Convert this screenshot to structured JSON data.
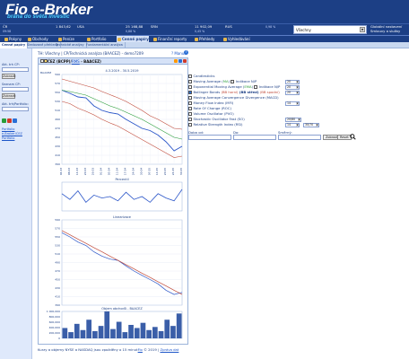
{
  "header": {
    "logo_main": "Fio e-Broker",
    "logo_tag": "brána do světa investic"
  },
  "ticker": [
    {
      "name": "ČR",
      "sub": "09:58",
      "value": "1 843,62",
      "change": ""
    },
    {
      "name": "USA",
      "sub": "",
      "value": "25 168,88",
      "change": "0,88 %"
    },
    {
      "name": "SRN",
      "sub": "",
      "value": "11 902,09",
      "change": "0,45 %"
    },
    {
      "name": "RUS",
      "sub": "",
      "value": "",
      "change": "0,98 %"
    }
  ],
  "account": {
    "selected": "Všechny"
  },
  "side_note": [
    "Globální nastavení",
    "Smlouvy a služby"
  ],
  "nav": [
    {
      "label": "Pokyny"
    },
    {
      "label": "Obchody"
    },
    {
      "label": "Peníze"
    },
    {
      "label": "Portfolio"
    },
    {
      "label": "Cenné papíry"
    },
    {
      "label": "Finanční reporty"
    },
    {
      "label": "Přehledy"
    },
    {
      "label": "Vyhledávání"
    }
  ],
  "subnav": [
    {
      "label": "Cenné papíry"
    },
    {
      "label": "Sledované přehledy"
    },
    {
      "label": "Technické analýzy"
    },
    {
      "label": "Fundamentální analýza"
    }
  ],
  "sidebar": {
    "label1": "Akt. trh CP:",
    "btn1": "Zobrazit",
    "label2": "Seznam CP:",
    "btn2": "Zobrazit",
    "label3": "Akt. trh/Portfolio:",
    "link1": "Portfolio",
    "link2": "e-Broker/ČEZ",
    "link3": "Portfolio"
  },
  "breadcrumb": "TH: Všechny | CP/Technická analýza (BAACEZ) - demo7209",
  "manual_label": "Manuál",
  "panel": {
    "title_prefix": "ČEZ (BCPP)/",
    "title_link": "RMS",
    "title_suffix": " - BAACEZ)"
  },
  "options": {
    "candlesticks": "Candlesticks",
    "ma_prefix": "Moving Average (",
    "ma_green": "MA",
    "ma_suffix": ")",
    "ind_np": "Indikace N/P",
    "ema_prefix": "Exponential Moving Average (",
    "ema_green": "EMA",
    "ema_suffix": ")",
    "bollinger_prefix": "Bollinger Bands",
    "bollinger_mid": " (BB horní) ",
    "bollinger_bold": "(BB střed)",
    "bollinger_suffix": " (BB spodní)",
    "macd": "Moving Average Convergence Divergence (MACD)",
    "mfi": "Money Flow Index (MFI)",
    "roc": "Rate Of Change (ROC)",
    "pvo": "Volume Oscillator (PVO)",
    "so": "Stochastic Oscillator Fast (SO)",
    "rsi": "Relative Strength Index (RSI)",
    "val_20": "20",
    "val_20b": "20",
    "val_20c": "20",
    "val_14": "14",
    "val_so": "20/80",
    "val_rsi1": "14",
    "val_rsi2": "30/70",
    "doba_od": "Doba od:",
    "do": "Do:",
    "smerna": "Směrný:",
    "zobrazit": "Zobrazit",
    "reset": "Reset"
  },
  "footer": {
    "text": "Kurzy a objemy NYSE a NASDAQ jsou zpožděny o 15 minut",
    "link1": "Fio",
    "year": " © 2019 | ",
    "link2": "Zpráva dat"
  },
  "chart_data": [
    {
      "type": "line",
      "title": "4.3.2019 - 30.5.2019",
      "ylabel": "BAACEZ",
      "ylim": [
        390,
        590
      ],
      "x": [
        "04.03",
        "08.03",
        "14.03",
        "20.03",
        "26.03",
        "01.04",
        "05.04",
        "11.04",
        "17.04",
        "24.04",
        "30.04",
        "07.05",
        "14.05",
        "20.05",
        "24.05",
        "30.05"
      ],
      "series": [
        {
          "name": "close",
          "values": [
            555,
            548,
            540,
            538,
            520,
            510,
            505,
            502,
            490,
            480,
            470,
            465,
            455,
            440,
            420,
            430
          ]
        },
        {
          "name": "BB horní",
          "values": [
            580,
            575,
            570,
            565,
            560,
            552,
            545,
            538,
            530,
            520,
            510,
            498,
            490,
            480,
            470,
            468
          ]
        },
        {
          "name": "BB spodní",
          "values": [
            530,
            525,
            515,
            508,
            500,
            490,
            482,
            475,
            465,
            455,
            445,
            435,
            425,
            415,
            405,
            408
          ]
        },
        {
          "name": "MA",
          "values": [
            555,
            552,
            548,
            544,
            536,
            528,
            520,
            514,
            506,
            498,
            490,
            480,
            470,
            460,
            450,
            446
          ]
        }
      ],
      "yticks": [
        390,
        410,
        430,
        450,
        470,
        490,
        510,
        530,
        550,
        570,
        590
      ],
      "grid": true
    },
    {
      "type": "line",
      "title": "Percentil",
      "values": [
        60,
        40,
        70,
        30,
        55,
        45,
        50,
        35,
        65,
        40,
        50,
        30,
        60,
        45,
        35,
        75
      ]
    },
    {
      "type": "line",
      "title": "Linearizace",
      "ylim": [
        390,
        590
      ],
      "series": [
        {
          "name": "close",
          "values": [
            560,
            550,
            538,
            530,
            515,
            505,
            498,
            495,
            482,
            470,
            460,
            450,
            440,
            425,
            415,
            420
          ]
        },
        {
          "name": "trend",
          "values": [
            565,
            555,
            545,
            535,
            525,
            515,
            505,
            495,
            485,
            475,
            465,
            455,
            445,
            435,
            425,
            415
          ]
        }
      ],
      "yticks": [
        390,
        410,
        430,
        450,
        470,
        490,
        510,
        530,
        550,
        570,
        590
      ]
    },
    {
      "type": "bar",
      "title": "Objem obchodů - BAACEZ",
      "values": [
        500,
        300,
        700,
        400,
        900,
        350,
        600,
        1300,
        450,
        800,
        300,
        650,
        500,
        750,
        400,
        550,
        350,
        900,
        600,
        1200
      ],
      "yticks": [
        "1 000,000",
        "800,000",
        "600,000",
        "400,000",
        "200,000",
        "0"
      ]
    }
  ]
}
